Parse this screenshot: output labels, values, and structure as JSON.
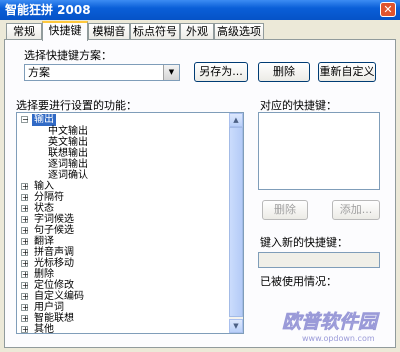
{
  "window": {
    "title": "智能狂拼 2008",
    "close_glyph": "✕"
  },
  "tabs": [
    {
      "label": "常规"
    },
    {
      "label": "快捷键"
    },
    {
      "label": "模糊音"
    },
    {
      "label": "标点符号"
    },
    {
      "label": "外观"
    },
    {
      "label": "高级选项"
    }
  ],
  "scheme": {
    "label": "选择快捷键方案：",
    "selected": "方案",
    "save_as": "另存为...",
    "delete": "删除",
    "redefine": "重新自定义"
  },
  "functions": {
    "label": "选择要进行设置的功能：",
    "items": [
      {
        "label": "输出",
        "expander": "−",
        "selected": true
      },
      {
        "label": "中文输出",
        "child": true
      },
      {
        "label": "英文输出",
        "child": true
      },
      {
        "label": "联想输出",
        "child": true
      },
      {
        "label": "逐词输出",
        "child": true
      },
      {
        "label": "逐词确认",
        "child": true
      },
      {
        "label": "输入",
        "expander": "+"
      },
      {
        "label": "分隔符",
        "expander": "+"
      },
      {
        "label": "状态",
        "expander": "+"
      },
      {
        "label": "字词候选",
        "expander": "+"
      },
      {
        "label": "句子候选",
        "expander": "+"
      },
      {
        "label": "翻译",
        "expander": "+"
      },
      {
        "label": "拼音声调",
        "expander": "+"
      },
      {
        "label": "光标移动",
        "expander": "+"
      },
      {
        "label": "删除",
        "expander": "+"
      },
      {
        "label": "定位修改",
        "expander": "+"
      },
      {
        "label": "自定义编码",
        "expander": "+"
      },
      {
        "label": "用户词",
        "expander": "+"
      },
      {
        "label": "智能联想",
        "expander": "+"
      },
      {
        "label": "其他",
        "expander": "+"
      }
    ]
  },
  "shortcuts": {
    "label": "对应的快捷键：",
    "delete": "删除",
    "add": "添加..."
  },
  "new_key": {
    "label": "键入新的快捷键：",
    "value": ""
  },
  "used_status": {
    "label": "已被使用情况："
  },
  "watermark": {
    "text": "欧普软件园",
    "url": "www.opdown.com"
  }
}
